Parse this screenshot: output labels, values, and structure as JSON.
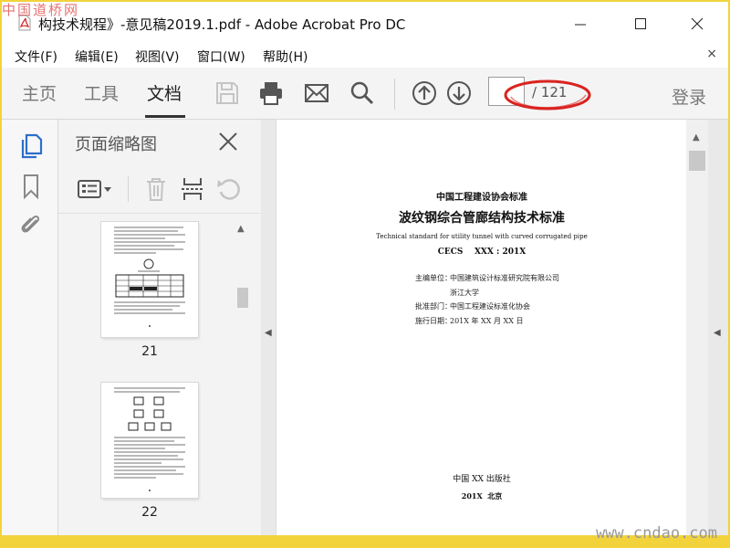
{
  "window": {
    "title": "构技术规程》-意见稿2019.1.pdf - Adobe Acrobat Pro DC"
  },
  "menu": {
    "items": [
      {
        "label": "文件(F)"
      },
      {
        "label": "编辑(E)"
      },
      {
        "label": "视图(V)"
      },
      {
        "label": "窗口(W)"
      },
      {
        "label": "帮助(H)"
      }
    ],
    "close_label": "×"
  },
  "toolbar": {
    "tabs": [
      {
        "label": "主页"
      },
      {
        "label": "工具"
      },
      {
        "label": "文档",
        "active": true
      }
    ],
    "page_current": "",
    "page_total": "/ 121",
    "login_label": "登录",
    "highlight_color": "#d9231f"
  },
  "panel": {
    "title": "页面缩略图",
    "thumbnails": [
      {
        "page": "21"
      },
      {
        "page": "22"
      }
    ]
  },
  "document": {
    "org": "中国工程建设协会标准",
    "title_cn": "波纹钢综合管廊结构技术标准",
    "title_en": "Technical standard for utility tunnel with curved corrugated pipe",
    "code": "CECS    XXX : 201X",
    "editor_label": "主编单位：",
    "editor_1": "中国建筑设计标准研究院有限公司",
    "editor_2": "浙江大学",
    "approver_label": "批准部门：",
    "approver": "中国工程建设标准化协会",
    "date_label": "施行日期：",
    "date": "201X 年 XX 月 XX 日",
    "publisher": "中国 XX 出版社",
    "place": "201X  北京"
  },
  "watermark": {
    "top": "中国道桥网",
    "bottom": "www.cndao.com"
  }
}
